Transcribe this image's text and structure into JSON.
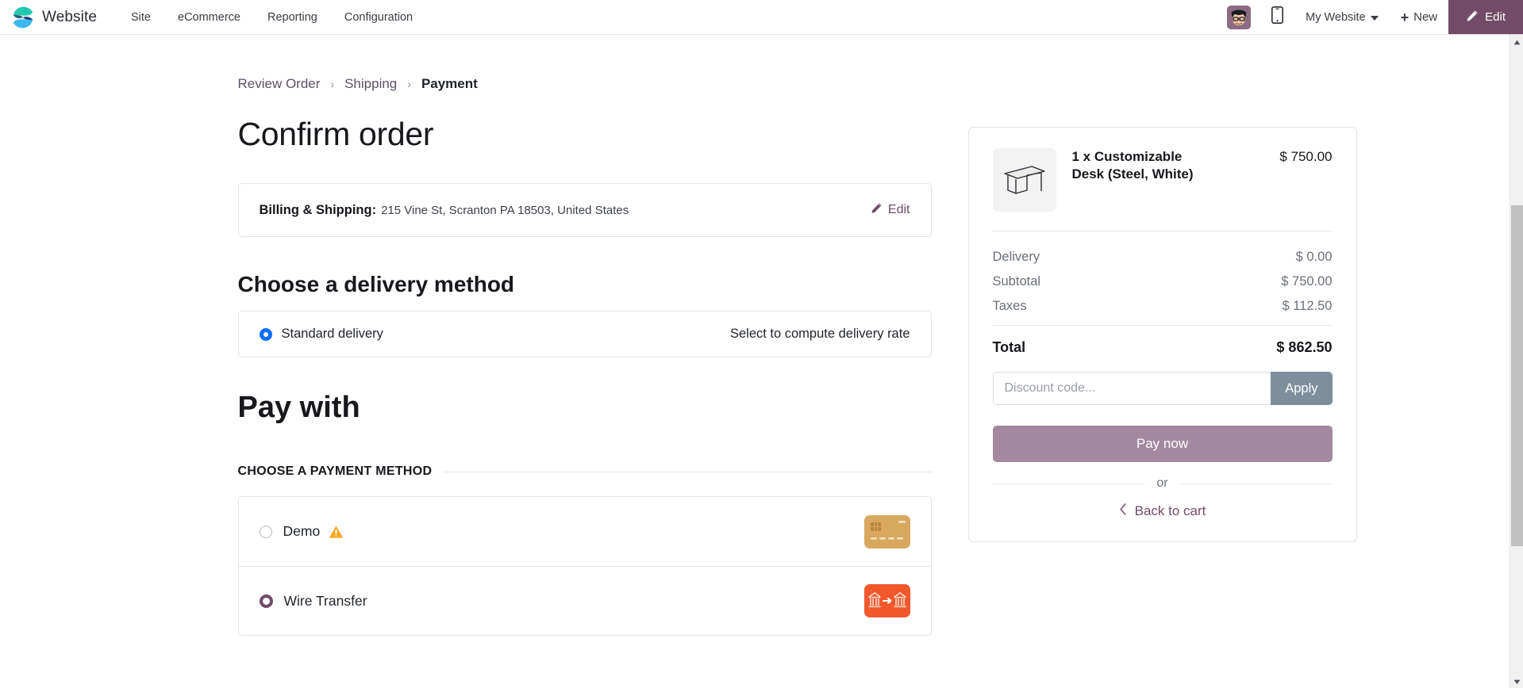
{
  "navbar": {
    "brand": "Website",
    "menu_items": [
      {
        "label": "Site"
      },
      {
        "label": "eCommerce"
      },
      {
        "label": "Reporting"
      },
      {
        "label": "Configuration"
      }
    ],
    "avatar_name": "user-avatar",
    "mobile_preview_icon": "mobile-icon",
    "website_selector": "My Website",
    "new_label": "New",
    "new_icon": "plus-icon",
    "edit_label": "Edit",
    "edit_icon": "pencil-icon",
    "edit_bg_color": "#714b67"
  },
  "breadcrumb": {
    "items": [
      {
        "label": "Review Order",
        "current": false
      },
      {
        "label": "Shipping",
        "current": false
      },
      {
        "label": "Payment",
        "current": true
      }
    ],
    "separator": "›"
  },
  "main": {
    "page_title": "Confirm order",
    "billing": {
      "label": "Billing & Shipping:",
      "address": "215 Vine St, Scranton PA 18503, United States",
      "edit_label": "Edit",
      "edit_icon": "pencil-icon"
    },
    "delivery": {
      "section_title": "Choose a delivery method",
      "option_name": "Standard delivery",
      "option_selected": true,
      "rate_text": "Select to compute delivery rate"
    },
    "payment": {
      "section_title": "Pay with",
      "choose_label": "CHOOSE A PAYMENT METHOD",
      "methods": [
        {
          "name": "Demo",
          "selected": false,
          "warning_icon": "warning-triangle-icon",
          "provider_icon": "credit-card-icon",
          "icon_color": "#d7a85e"
        },
        {
          "name": "Wire Transfer",
          "selected": true,
          "warning_icon": null,
          "provider_icon": "bank-transfer-icon",
          "icon_color": "#f0582c"
        }
      ]
    }
  },
  "summary": {
    "product": {
      "name": "1 x Customizable Desk (Steel, White)",
      "price": "$ 750.00",
      "thumb_icon": "desk-icon"
    },
    "amounts": [
      {
        "label": "Delivery",
        "value": "$ 0.00"
      },
      {
        "label": "Subtotal",
        "value": "$ 750.00"
      },
      {
        "label": "Taxes",
        "value": "$ 112.50"
      }
    ],
    "total": {
      "label": "Total",
      "value": "$ 862.50"
    },
    "discount": {
      "placeholder": "Discount code...",
      "value": "",
      "apply_label": "Apply"
    },
    "pay_now_label": "Pay now",
    "pay_now_color": "#a4899e",
    "or_text": "or",
    "back_to_cart_label": "Back to cart",
    "back_icon": "chevron-left-icon"
  },
  "scrollbar": {
    "up_icon": "caret-up-icon",
    "down_icon": "caret-down-icon"
  }
}
